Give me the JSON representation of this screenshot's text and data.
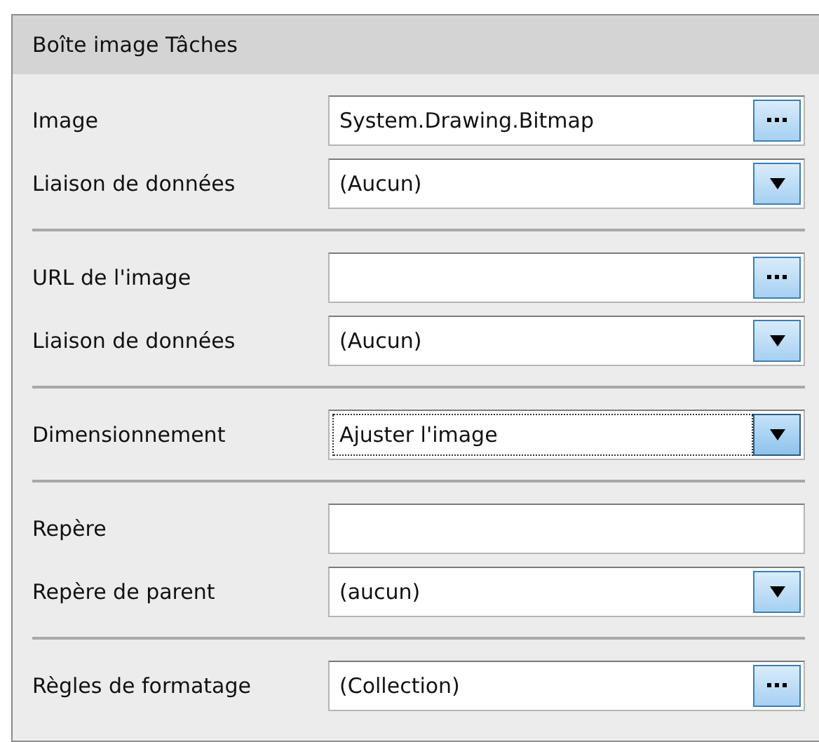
{
  "title": "Boîte image Tâches",
  "sections": [
    {
      "rows": [
        {
          "label": "Image",
          "value": "System.Drawing.Bitmap",
          "kind": "ellipsis",
          "focused": false
        },
        {
          "label": "Liaison de données",
          "value": "(Aucun)",
          "kind": "dropdown",
          "focused": false
        }
      ]
    },
    {
      "rows": [
        {
          "label": "URL de l'image",
          "value": "",
          "kind": "ellipsis",
          "focused": false
        },
        {
          "label": "Liaison de données",
          "value": "(Aucun)",
          "kind": "dropdown",
          "focused": false
        }
      ]
    },
    {
      "rows": [
        {
          "label": "Dimensionnement",
          "value": "Ajuster l'image",
          "kind": "dropdown",
          "focused": true
        }
      ]
    },
    {
      "rows": [
        {
          "label": "Repère",
          "value": "",
          "kind": "text",
          "focused": false
        },
        {
          "label": "Repère de parent",
          "value": "(aucun)",
          "kind": "dropdown",
          "focused": false
        }
      ]
    },
    {
      "rows": [
        {
          "label": "Règles de formatage",
          "value": "(Collection)",
          "kind": "ellipsis",
          "focused": false
        }
      ]
    }
  ]
}
